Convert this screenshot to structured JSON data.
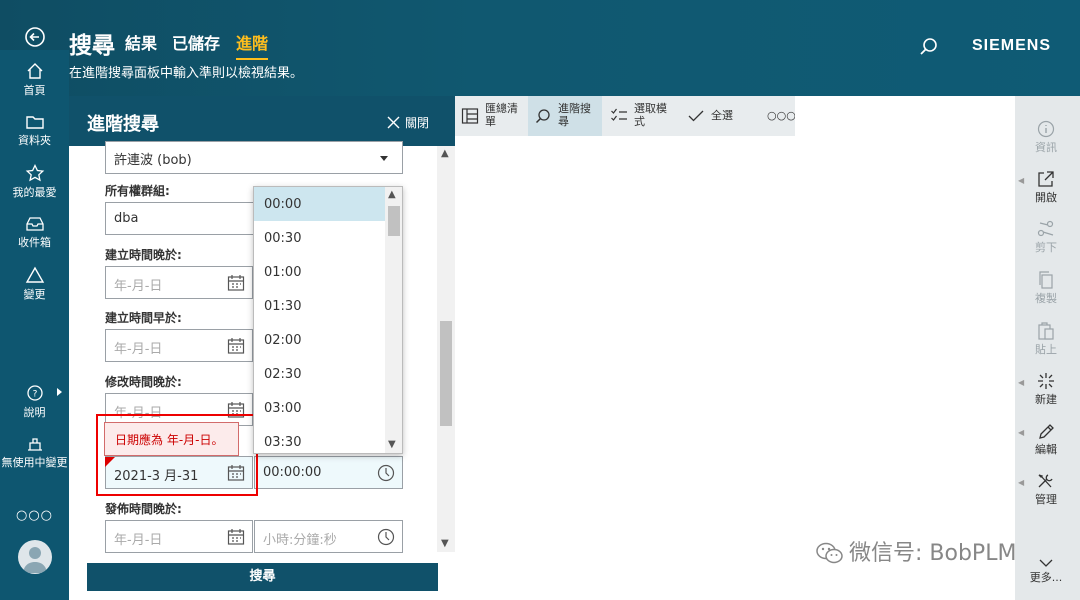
{
  "header": {
    "title": "搜尋",
    "tabs": [
      "結果",
      "已儲存",
      "進階"
    ],
    "active_tab": "進階",
    "subtitle": "在進階搜尋面板中輸入準則以檢視結果。",
    "brand": "SIEMENS"
  },
  "leftnav": {
    "items": [
      {
        "label": "首頁",
        "icon": "home-icon"
      },
      {
        "label": "資料夾",
        "icon": "folder-icon"
      },
      {
        "label": "我的最愛",
        "icon": "star-icon"
      },
      {
        "label": "收件箱",
        "icon": "inbox-icon"
      },
      {
        "label": "變更",
        "icon": "change-icon"
      },
      {
        "label": "說明",
        "icon": "help-icon"
      },
      {
        "label": "無使用中變更",
        "icon": "no-active-change-icon"
      }
    ],
    "more": "○○○"
  },
  "panel": {
    "title": "進階搜尋",
    "close_label": "關閉",
    "owner_value": "許連波 (bob)",
    "group_label": "所有權群組:",
    "group_value": "dba",
    "created_after_label": "建立時間晚於:",
    "created_before_label": "建立時間早於:",
    "modified_after_label": "修改時間晚於:",
    "date_placeholder": "年-月-日",
    "modified_before_value": "2021-3 月-31",
    "time_value": "00:00:00",
    "released_after_label": "發佈時間晚於:",
    "time_placeholder": "小時:分鐘:秒",
    "search_button": "搜尋",
    "error_message": "日期應為 年-月-日。",
    "time_options": [
      "00:00",
      "00:30",
      "01:00",
      "01:30",
      "02:00",
      "02:30",
      "03:00",
      "03:30"
    ],
    "selected_time": "00:00"
  },
  "toolbar": {
    "items": [
      "匯總清單",
      "進階搜尋",
      "選取模式",
      "全選"
    ],
    "more": "○○○"
  },
  "rightbar": {
    "items": [
      {
        "label": "資訊",
        "icon": "info-icon",
        "enabled": false
      },
      {
        "label": "開啟",
        "icon": "open-icon",
        "enabled": true
      },
      {
        "label": "剪下",
        "icon": "cut-icon",
        "enabled": false
      },
      {
        "label": "複製",
        "icon": "copy-icon",
        "enabled": false
      },
      {
        "label": "貼上",
        "icon": "paste-icon",
        "enabled": false
      },
      {
        "label": "新建",
        "icon": "new-icon",
        "enabled": true
      },
      {
        "label": "編輯",
        "icon": "edit-icon",
        "enabled": true
      },
      {
        "label": "管理",
        "icon": "manage-icon",
        "enabled": true
      },
      {
        "label": "更多...",
        "icon": "more-icon",
        "enabled": true
      }
    ]
  },
  "watermark": "微信号: BobPLM",
  "colors": {
    "header": "#0f5570",
    "accent": "#ffbe1d",
    "error": "#dd0000",
    "selected": "#cde6ef"
  }
}
